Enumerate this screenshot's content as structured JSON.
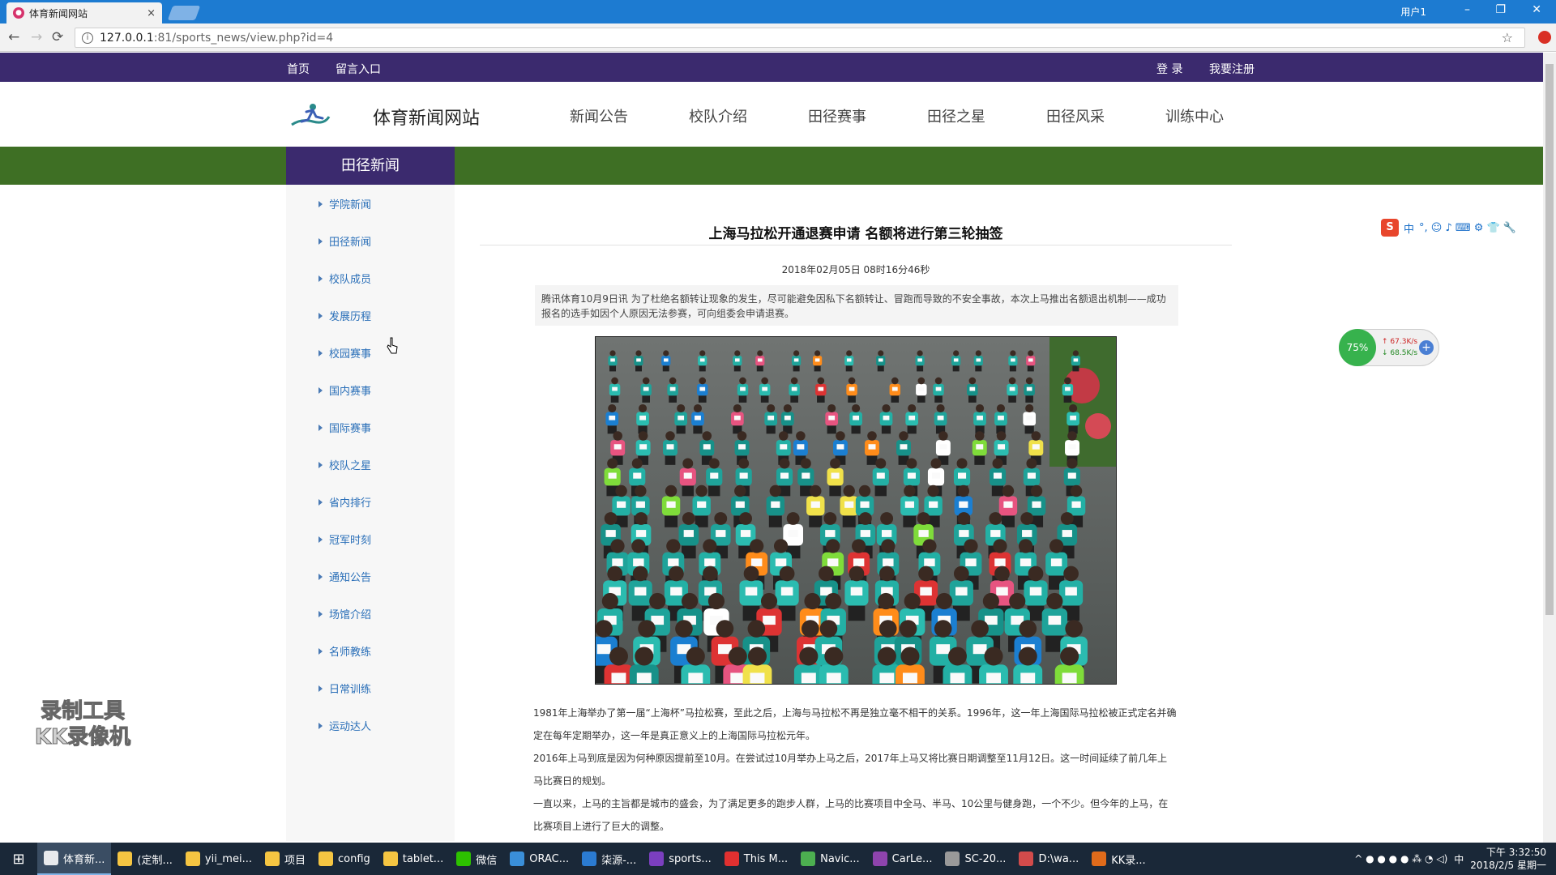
{
  "browser": {
    "tab_title": "体育新闻网站",
    "tab_close": "×",
    "window_user": "用户1",
    "win_min": "–",
    "win_max": "❐",
    "win_close": "✕",
    "url_host": "127.0.0.1",
    "url_rest": ":81/sports_news/view.php?id=4",
    "back": "←",
    "forward": "→",
    "reload": "⟳",
    "star": "☆"
  },
  "site_top": {
    "home": "首页",
    "guestbook": "留言入口",
    "login": "登 录",
    "register": "我要注册"
  },
  "header": {
    "site_name": "体育新闻网站",
    "nav": [
      "新闻公告",
      "校队介绍",
      "田径赛事",
      "田径之星",
      "田径风采",
      "训练中心"
    ]
  },
  "band_title": "田径新闻",
  "sidebar": {
    "items": [
      "学院新闻",
      "田径新闻",
      "校队成员",
      "发展历程",
      "校园赛事",
      "国内赛事",
      "国际赛事",
      "校队之星",
      "省内排行",
      "冠军时刻",
      "通知公告",
      "场馆介绍",
      "名师教练",
      "日常训练",
      "运动达人"
    ]
  },
  "article": {
    "title": "上海马拉松开通退赛申请 名额将进行第三轮抽签",
    "date": "2018年02月05日 08时16分46秒",
    "summary": "腾讯体育10月9日讯 为了杜绝名额转让现象的发生，尽可能避免因私下名额转让、冒跑而导致的不安全事故，本次上马推出名额退出机制——成功报名的选手如因个人原因无法参赛，可向组委会申请退赛。",
    "paragraphs": [
      "1981年上海举办了第一届“上海杯”马拉松赛，至此之后，上海与马拉松不再是独立毫不相干的关系。1996年，这一年上海国际马拉松被正式定名并确定在每年定期举办，这一年是真正意义上的上海国际马拉松元年。",
      "2016年上马到底是因为何种原因提前至10月。在尝试过10月举办上马之后，2017年上马又将比赛日期调整至11月12日。这一时间延续了前几年上马比赛日的规划。",
      "一直以来，上马的主旨都是城市的盛会，为了满足更多的跑步人群，上马的比赛项目中全马、半马、10公里与健身跑，一个不少。但今年的上马，在比赛项目上进行了巨大的调整。"
    ]
  },
  "widgets": {
    "ime_s": "S",
    "ime_lang": "中",
    "ime_icons": "°, ☺ ♪ ⌨ ⚙ 👕 🔧",
    "net_percent": "75%",
    "net_up": "↑ 67.3K/s",
    "net_down": "↓ 68.5K/s",
    "net_plus": "+",
    "watermark_line1": "录制工具",
    "watermark_line2": "KK录像机"
  },
  "taskbar": {
    "start": "⊞",
    "items": [
      "体育新...",
      "(定制...",
      "yii_mei...",
      "项目",
      "config",
      "tablet...",
      "微信",
      "ORAC...",
      "柒源-...",
      "sports...",
      "This M...",
      "Navic...",
      "CarLe...",
      "SC-20...",
      "D:\\wa...",
      "KK录..."
    ],
    "tray_lang": "中",
    "tray_icons": "^ ● ● ● ● ⁂ ◔ ◁)",
    "clock_time": "下午 3:32:50",
    "clock_date": "2018/2/5 星期一"
  },
  "colors": {
    "site_purple": "#3b2a6e",
    "band_green": "#3e6f24",
    "chrome_blue": "#1d7bd1",
    "link_blue": "#2a6fb8"
  }
}
